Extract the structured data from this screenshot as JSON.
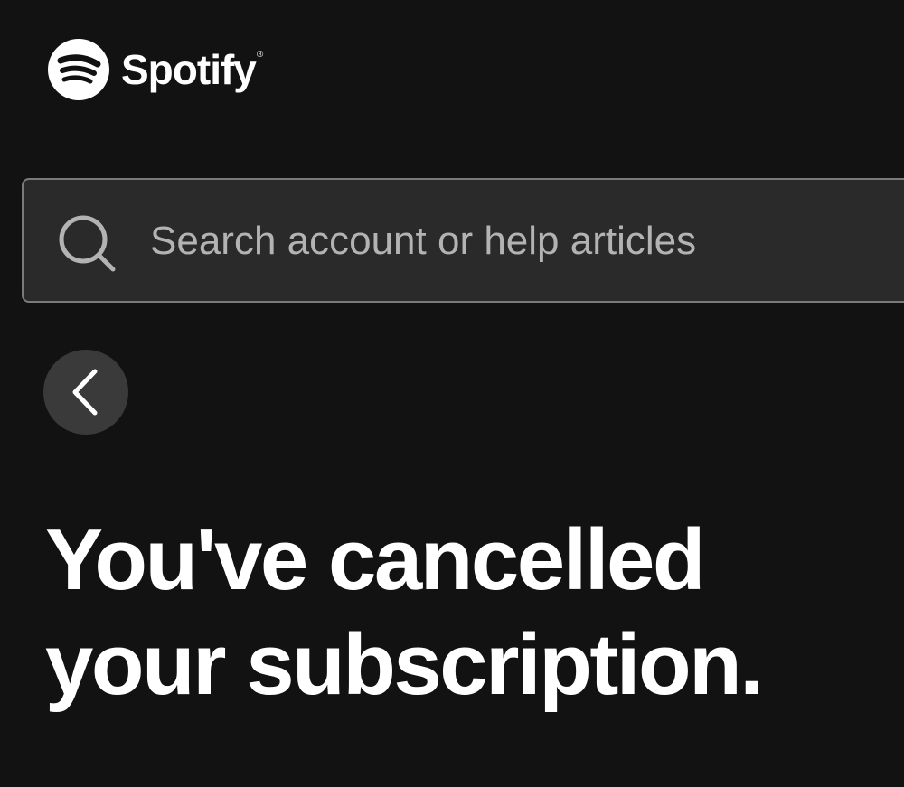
{
  "brand": {
    "name": "Spotify",
    "registered_mark": "®",
    "logo_icon": "spotify-logo-icon"
  },
  "search": {
    "placeholder": "Search account or help articles",
    "value": "",
    "icon": "search-icon"
  },
  "navigation": {
    "back_icon": "chevron-left-icon"
  },
  "main": {
    "title_line1": "You've cancelled",
    "title_line2": "your subscription."
  },
  "colors": {
    "background": "#121212",
    "search_background": "#2a2a2a",
    "search_border": "#7a7a7a",
    "back_button_background": "#3a3a3a",
    "placeholder_text": "#b3b3b3",
    "text": "#ffffff"
  }
}
